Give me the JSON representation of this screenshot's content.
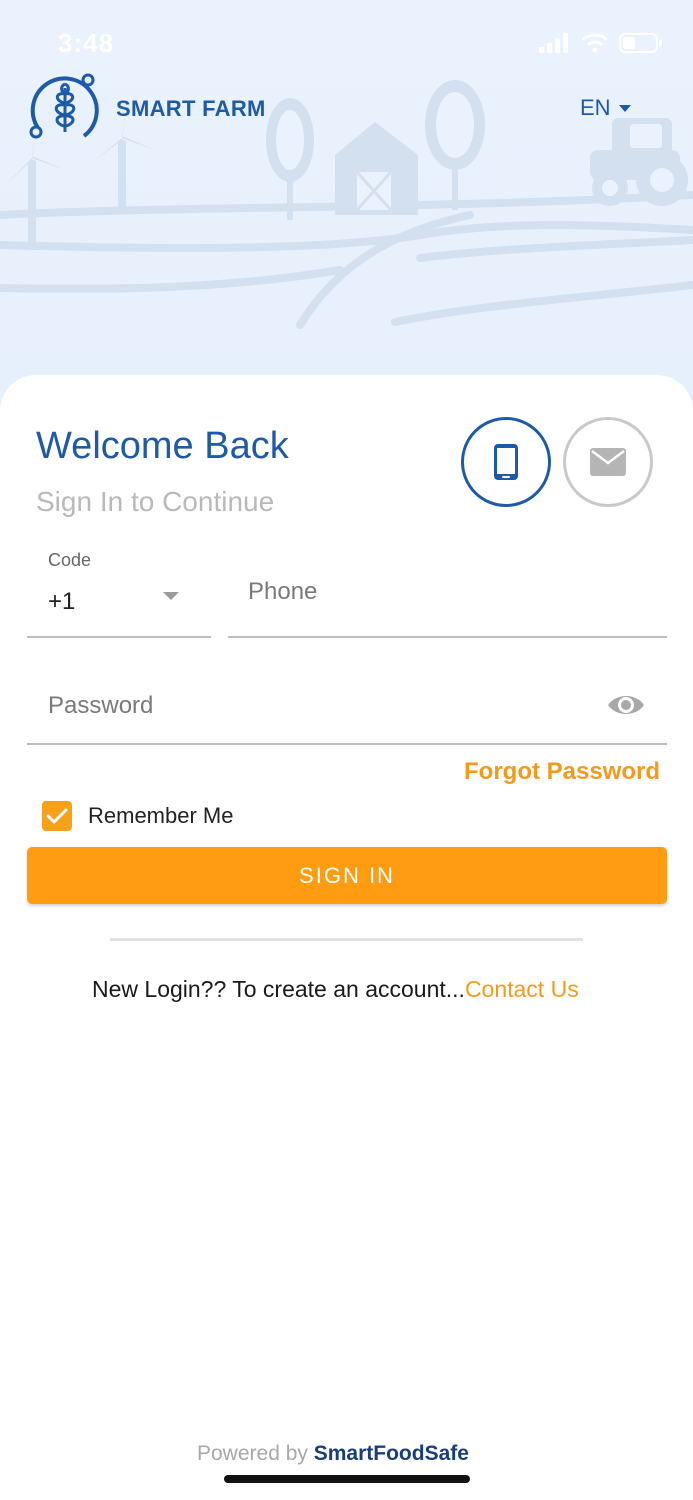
{
  "status_bar": {
    "time": "3:48"
  },
  "brand": {
    "name": "SMART FARM",
    "logo_icon": "wheat-logo-icon"
  },
  "language": {
    "selected": "EN"
  },
  "login": {
    "title": "Welcome Back",
    "subtitle": "Sign In to Continue",
    "modes": [
      {
        "name": "phone",
        "icon": "smartphone-icon",
        "selected": true
      },
      {
        "name": "email",
        "icon": "envelope-icon",
        "selected": false
      }
    ],
    "code_label": "Code",
    "code_value": "+1",
    "phone_placeholder": "Phone",
    "password_placeholder": "Password",
    "forgot_password": "Forgot Password",
    "remember_me": "Remember Me",
    "remember_checked": true,
    "sign_in": "SIGN IN",
    "new_login_text": "New Login?? To create an account...",
    "contact_us": "Contact Us"
  },
  "footer": {
    "powered_by": "Powered by",
    "company": "SmartFoodSafe"
  },
  "colors": {
    "primary": "#1d5aa8",
    "accent": "#ff9c12",
    "header_bg": "#e8f0fc"
  }
}
